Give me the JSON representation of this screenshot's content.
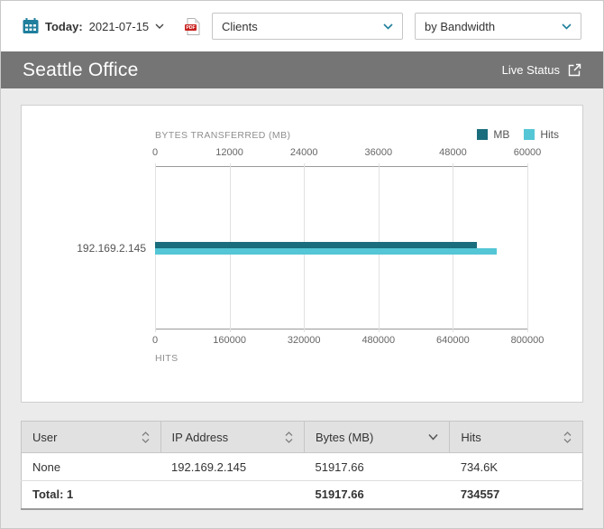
{
  "toolbar": {
    "date_label": "Today:",
    "date_value": "2021-07-15",
    "report_select_value": "Clients",
    "view_select_value": "by Bandwidth",
    "icons": [
      "calendar-icon",
      "pdf-export-icon",
      "chevron-down-icon"
    ]
  },
  "header": {
    "title": "Seattle Office",
    "live_status": "Live Status",
    "icons": [
      "external-link-icon"
    ]
  },
  "chart_data": {
    "type": "bar",
    "orientation": "horizontal",
    "categories": [
      "192.169.2.145"
    ],
    "series": [
      {
        "name": "MB",
        "values": [
          51917.66
        ],
        "axis": "top",
        "axis_max": 60000,
        "color": "#1a6d7c"
      },
      {
        "name": "Hits",
        "values": [
          734557
        ],
        "axis": "bottom",
        "axis_max": 800000,
        "color": "#54c6d6"
      }
    ],
    "top_axis": {
      "label": "BYTES TRANSFERRED (MB)",
      "min": 0,
      "max": 60000,
      "ticks": [
        "0",
        "12000",
        "24000",
        "36000",
        "48000",
        "60000"
      ]
    },
    "bottom_axis": {
      "label": "HITS",
      "min": 0,
      "max": 800000,
      "ticks": [
        "0",
        "160000",
        "320000",
        "480000",
        "640000",
        "800000"
      ]
    },
    "legend": [
      {
        "label": "MB",
        "color": "#1a6d7c"
      },
      {
        "label": "Hits",
        "color": "#54c6d6"
      }
    ],
    "grid": true,
    "legend_position": "top-right"
  },
  "table": {
    "columns": [
      {
        "label": "User",
        "sort": "both"
      },
      {
        "label": "IP Address",
        "sort": "both"
      },
      {
        "label": "Bytes (MB)",
        "sort": "desc"
      },
      {
        "label": "Hits",
        "sort": "both"
      }
    ],
    "rows": [
      [
        "None",
        "192.169.2.145",
        "51917.66",
        "734.6K"
      ]
    ],
    "total_row": [
      "Total: 1",
      "",
      "51917.66",
      "734557"
    ]
  },
  "colors": {
    "accent_teal": "#1a6d7c",
    "accent_cyan": "#54c6d6",
    "header_bg": "#757575",
    "content_bg": "#ebebeb",
    "icon_teal": "#1f7f9c",
    "pdf_red": "#c8201d"
  }
}
